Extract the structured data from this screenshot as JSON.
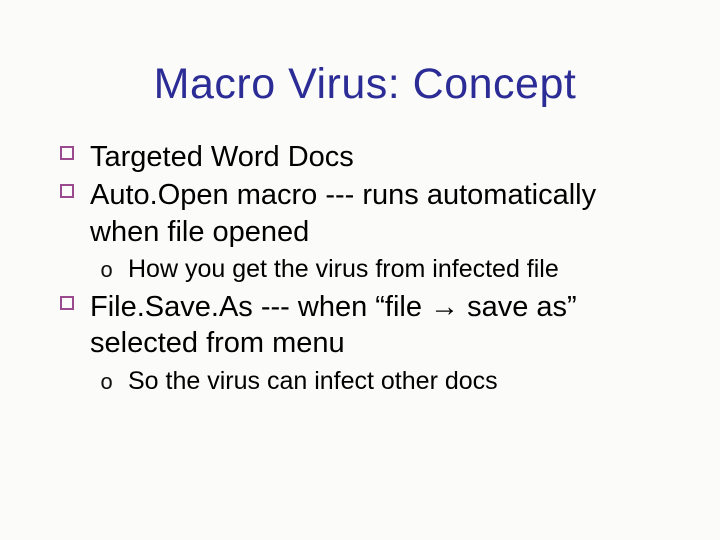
{
  "slide": {
    "title": "Macro Virus: Concept",
    "bullets": [
      {
        "level": 1,
        "text": "Targeted Word Docs"
      },
      {
        "level": 1,
        "text": "Auto.Open macro --- runs automatically when file opened"
      },
      {
        "level": 2,
        "text": "How you get the virus from infected file"
      },
      {
        "level": 1,
        "text": "File.Save.As --- when “file → save as” selected from menu"
      },
      {
        "level": 2,
        "text": "So the virus can infect other docs"
      }
    ]
  }
}
